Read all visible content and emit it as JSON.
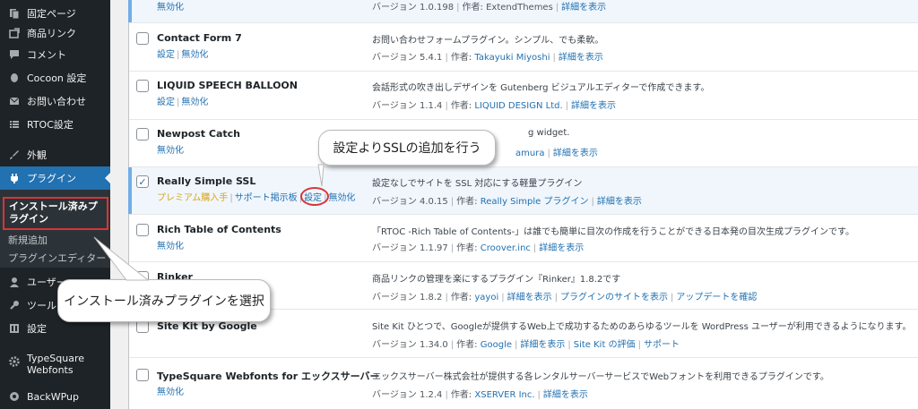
{
  "sidebar": {
    "items": [
      {
        "label": "固定ページ",
        "icon": "page-icon"
      },
      {
        "label": "商品リンク",
        "icon": "link-icon"
      },
      {
        "label": "コメント",
        "icon": "comment-icon"
      },
      {
        "label": "Cocoon 設定",
        "icon": "cocoon-icon"
      },
      {
        "label": "お問い合わせ",
        "icon": "mail-icon"
      },
      {
        "label": "RTOC設定",
        "icon": "list-icon"
      },
      {
        "label": "外観",
        "icon": "brush-icon"
      },
      {
        "label": "プラグイン",
        "icon": "plugin-icon"
      },
      {
        "label": "ユーザー",
        "icon": "user-icon"
      },
      {
        "label": "ツール",
        "icon": "wrench-icon"
      },
      {
        "label": "設定",
        "icon": "settings-icon"
      },
      {
        "label": "TypeSquare Webfonts",
        "icon": "gear-icon"
      },
      {
        "label": "BackWPup",
        "icon": "backwpup-icon"
      }
    ],
    "submenu": {
      "current": "インストール済みプラグイン",
      "items": [
        "新規追加",
        "プラグインエディター"
      ]
    }
  },
  "plugins": [
    {
      "name": "",
      "actions": [
        "無効化"
      ],
      "description": "",
      "version": "バージョン 1.0.198",
      "author_prefix": "作者:",
      "author": "ExtendThemes",
      "links": [
        "詳細を表示"
      ]
    },
    {
      "name": "Contact Form 7",
      "actions": [
        "設定",
        "無効化"
      ],
      "description": "お問い合わせフォームプラグイン。シンプル、でも柔軟。",
      "version": "バージョン 5.4.1",
      "author_prefix": "作者:",
      "author": "Takayuki Miyoshi",
      "links": [
        "詳細を表示"
      ]
    },
    {
      "name": "LIQUID SPEECH BALLOON",
      "actions": [
        "設定",
        "無効化"
      ],
      "description": "会話形式の吹き出しデザインを Gutenberg ビジュアルエディターで作成できます。",
      "version": "バージョン 1.1.4",
      "author_prefix": "作者:",
      "author": "LIQUID DESIGN Ltd.",
      "links": [
        "詳細を表示"
      ]
    },
    {
      "name": "Newpost Catch",
      "actions": [
        "無効化"
      ],
      "description": "g widget.",
      "version": "",
      "author_prefix": "",
      "author": "amura",
      "links": [
        "詳細を表示"
      ]
    },
    {
      "name": "Really Simple SSL",
      "actions": [
        "プレミアム購入手",
        "サポート掲示板",
        "設定",
        "無効化"
      ],
      "description": "設定なしでサイトを SSL 対応にする軽量プラグイン",
      "version": "バージョン 4.0.15",
      "author_prefix": "作者:",
      "author": "Really Simple プラグイン",
      "links": [
        "詳細を表示"
      ]
    },
    {
      "name": "Rich Table of Contents",
      "actions": [
        "無効化"
      ],
      "description": "「RTOC -Rich Table of Contents-」は誰でも簡単に目次の作成を行うことができる日本発の目次生成プラグインです。",
      "version": "バージョン 1.1.97",
      "author_prefix": "作者:",
      "author": "Croover.inc",
      "links": [
        "詳細を表示"
      ]
    },
    {
      "name": "Rinker",
      "actions": [],
      "description": "商品リンクの管理を楽にするプラグイン『Rinker』1.8.2です",
      "version": "バージョン 1.8.2",
      "author_prefix": "作者:",
      "author": "yayoi",
      "links": [
        "詳細を表示",
        "プラグインのサイトを表示",
        "アップデートを確認"
      ]
    },
    {
      "name": "Site Kit by Google",
      "actions": [],
      "description": "Site Kit ひとつで、Googleが提供するWeb上で成功するためのあらゆるツールを WordPress ユーザーが利用できるようになります。",
      "version": "バージョン 1.34.0",
      "author_prefix": "作者:",
      "author": "Google",
      "links": [
        "詳細を表示",
        "Site Kit の評価",
        "サポート"
      ]
    },
    {
      "name": "TypeSquare Webfonts for エックスサーバー",
      "actions": [
        "無効化"
      ],
      "description": "エックスサーバー株式会社が提供する各レンタルサーバーサービスでWebフォントを利用できるプラグインです。",
      "version": "バージョン 1.2.4",
      "author_prefix": "作者:",
      "author": "XSERVER Inc.",
      "links": [
        "詳細を表示"
      ]
    }
  ],
  "callouts": {
    "top": "設定よりSSLの追加を行う",
    "bottom": "インストール済みプラグインを選択"
  },
  "colors": {
    "sidebar_bg": "#1d2327",
    "active_menu": "#2271b1",
    "link": "#2271b1",
    "premium": "#dba617",
    "highlight_red": "#d63638"
  }
}
